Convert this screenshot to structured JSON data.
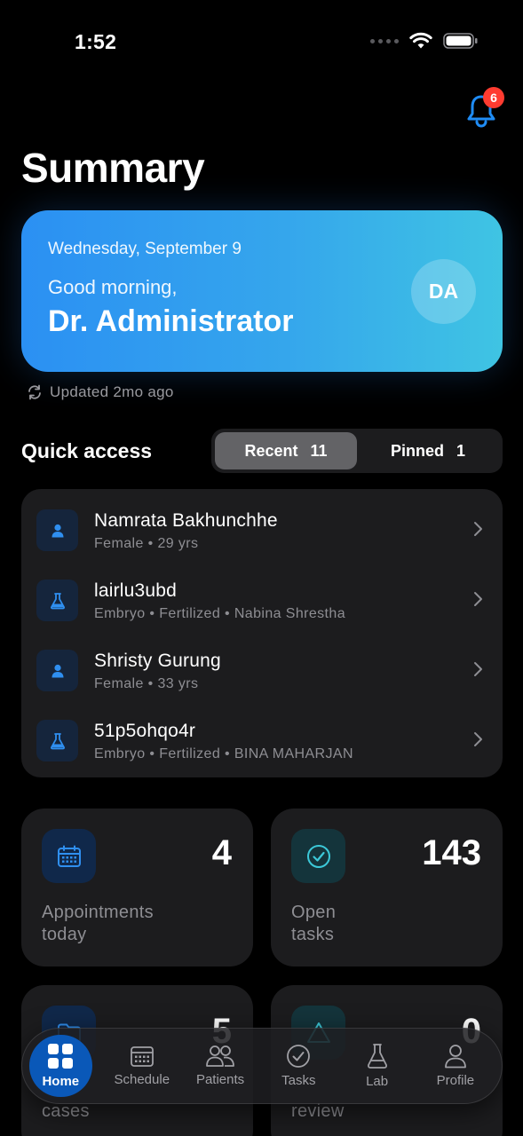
{
  "status_bar": {
    "time": "1:52"
  },
  "notifications": {
    "count": "6"
  },
  "page": {
    "title": "Summary"
  },
  "greeting": {
    "date": "Wednesday, September 9",
    "hello": "Good morning,",
    "name": "Dr. Administrator",
    "initials": "DA",
    "updated": "Updated 2mo ago"
  },
  "quick_access": {
    "title": "Quick access",
    "tabs": [
      {
        "label": "Recent",
        "count": "11",
        "active": true
      },
      {
        "label": "Pinned",
        "count": "1",
        "active": false
      }
    ],
    "items": [
      {
        "title": "Namrata Bakhunchhe",
        "subtitle": "Female • 29 yrs",
        "icon": "person-icon"
      },
      {
        "title": "lairlu3ubd",
        "subtitle": "Embryo • Fertilized • Nabina Shrestha",
        "icon": "flask-icon"
      },
      {
        "title": "Shristy Gurung",
        "subtitle": "Female • 33 yrs",
        "icon": "person-icon"
      },
      {
        "title": "51p5ohqo4r",
        "subtitle": "Embryo • Fertilized • BINA  MAHARJAN",
        "icon": "flask-icon"
      }
    ]
  },
  "stats": [
    {
      "value": "4",
      "label_line1": "Appointments",
      "label_line2": "today",
      "icon": "calendar-icon",
      "accent": "#2f8ff0"
    },
    {
      "value": "143",
      "label_line1": "Open",
      "label_line2": "tasks",
      "icon": "check-circle-icon",
      "accent": "#3cc8d8"
    },
    {
      "value": "5",
      "label_line1": "",
      "label_line2": "cases",
      "icon": "folder-icon",
      "accent": "#2f8ff0"
    },
    {
      "value": "0",
      "label_line1": "",
      "label_line2": "review",
      "icon": "alert-icon",
      "accent": "#3cc8d8"
    }
  ],
  "tab_bar": {
    "tabs": [
      {
        "label": "Home",
        "icon": "grid-icon",
        "active": true
      },
      {
        "label": "Schedule",
        "icon": "calendar-icon"
      },
      {
        "label": "Patients",
        "icon": "users-icon"
      },
      {
        "label": "Tasks",
        "icon": "check-circle-icon"
      },
      {
        "label": "Lab",
        "icon": "flask-icon"
      },
      {
        "label": "Profile",
        "icon": "user-icon"
      }
    ]
  },
  "colors": {
    "accent": "#2b90f3",
    "card_bg": "#1c1c1e",
    "badge": "#ff3b30"
  }
}
